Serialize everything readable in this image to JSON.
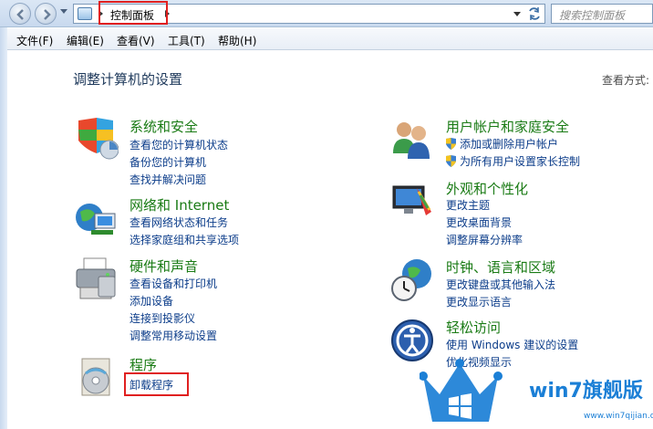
{
  "address_bar": {
    "breadcrumb": "控制面板",
    "search_placeholder": "搜索控制面板"
  },
  "menu": {
    "items": [
      "文件(F)",
      "编辑(E)",
      "查看(V)",
      "工具(T)",
      "帮助(H)"
    ]
  },
  "main": {
    "title": "调整计算机的设置",
    "view_by_label": "查看方式:"
  },
  "categories": {
    "system_security": {
      "title": "系统和安全",
      "links": [
        "查看您的计算机状态",
        "备份您的计算机",
        "查找并解决问题"
      ]
    },
    "network": {
      "title": "网络和 Internet",
      "links": [
        "查看网络状态和任务",
        "选择家庭组和共享选项"
      ]
    },
    "hardware": {
      "title": "硬件和声音",
      "links": [
        "查看设备和打印机",
        "添加设备",
        "连接到投影仪",
        "调整常用移动设置"
      ]
    },
    "programs": {
      "title": "程序",
      "links": [
        "卸载程序"
      ]
    },
    "user_accounts": {
      "title": "用户帐户和家庭安全",
      "links": [
        "添加或删除用户帐户",
        "为所有用户设置家长控制"
      ]
    },
    "appearance": {
      "title": "外观和个性化",
      "links": [
        "更改主题",
        "更改桌面背景",
        "调整屏幕分辨率"
      ]
    },
    "clock": {
      "title": "时钟、语言和区域",
      "links": [
        "更改键盘或其他输入法",
        "更改显示语言"
      ]
    },
    "ease": {
      "title": "轻松访问",
      "links": [
        "使用 Windows 建议的设置",
        "优化视频显示"
      ]
    }
  },
  "watermark": {
    "text": "win7旗舰版",
    "url": "www.win7qijian.com"
  },
  "colors": {
    "category_title": "#1a7b15",
    "link": "#0c3d8a",
    "highlight": "#e02020",
    "watermark": "#1b7fd6"
  }
}
